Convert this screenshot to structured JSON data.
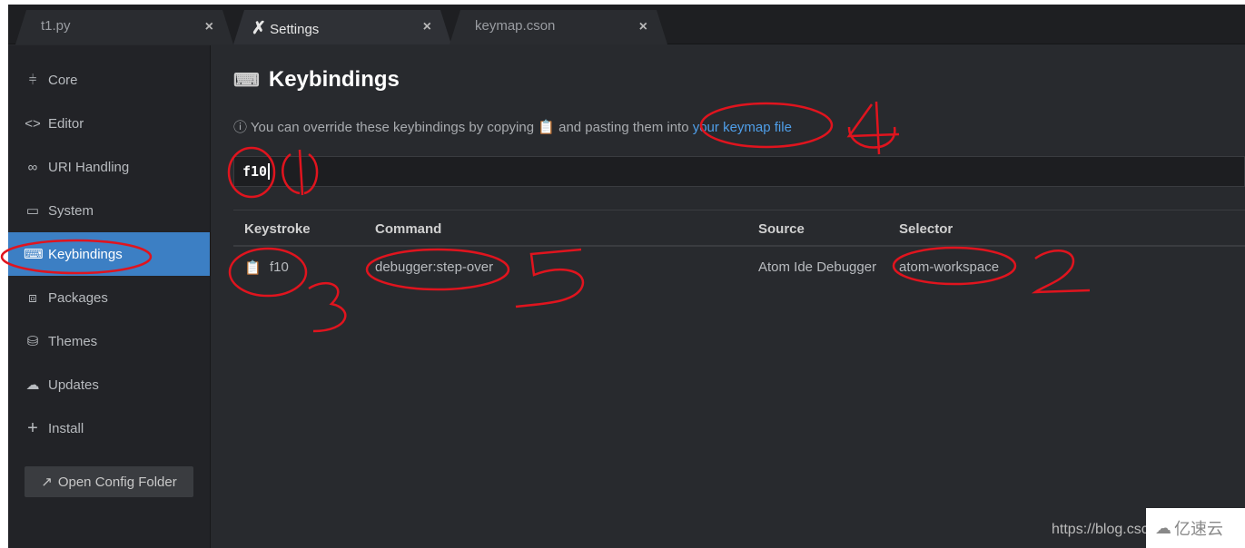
{
  "tabs": [
    {
      "label": "t1.py",
      "close": "×"
    },
    {
      "label": "Settings",
      "icon": "tools-icon",
      "close": "×"
    },
    {
      "label": "keymap.cson",
      "close": "×"
    }
  ],
  "sidebar": {
    "items": [
      {
        "label": "Core",
        "icon": "sliders-icon"
      },
      {
        "label": "Editor",
        "icon": "code-icon"
      },
      {
        "label": "URI Handling",
        "icon": "link-icon"
      },
      {
        "label": "System",
        "icon": "monitor-icon"
      },
      {
        "label": "Keybindings",
        "icon": "keyboard-icon",
        "active": true
      },
      {
        "label": "Packages",
        "icon": "package-icon"
      },
      {
        "label": "Themes",
        "icon": "paintcan-icon"
      },
      {
        "label": "Updates",
        "icon": "cloud-download-icon"
      },
      {
        "label": "Install",
        "icon": "plus-icon"
      }
    ],
    "open_config": "Open Config Folder"
  },
  "main": {
    "title": "Keybindings",
    "hint_before": "You can override these keybindings by copying",
    "hint_middle": "and pasting them into",
    "hint_link": "your keymap file",
    "search_value": "f10",
    "columns": [
      "Keystroke",
      "Command",
      "Source",
      "Selector"
    ],
    "rows": [
      {
        "keystroke": "f10",
        "command": "debugger:step-over",
        "source": "Atom Ide Debugger",
        "selector": "atom-workspace"
      }
    ]
  },
  "watermark": {
    "url": "https://blog.csc",
    "brand": "亿速云"
  },
  "colors": {
    "accent": "#3c7fc4",
    "link": "#4f9ee8",
    "annotation": "#e0141e"
  }
}
